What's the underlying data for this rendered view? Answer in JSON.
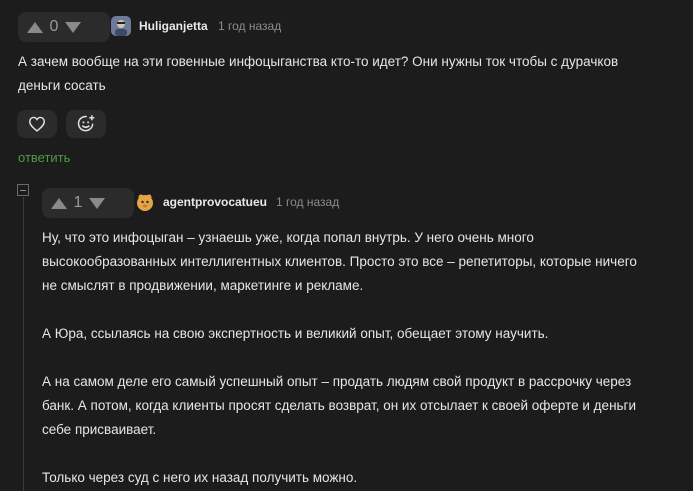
{
  "comment_main": {
    "votes": "0",
    "username": "Huliganjetta",
    "time": "1 год назад",
    "text": "А зачем вообще на эти говенные инфоцыганства кто-то идет? Они нужны ток чтобы с дурачков деньги сосать",
    "reply_label": "ответить"
  },
  "comment_reply": {
    "votes": "1",
    "username": "agentprovocatueu",
    "time": "1 год назад",
    "paragraphs": [
      "Ну, что это инфоцыган – узнаешь уже, когда попал внутрь. У него очень много высокообразованных интеллигентных клиентов. Просто это все – репетиторы, которые ничего не смыслят в продвижении, маркетинге и рекламе.",
      "А Юра, ссылаясь на свою экспертность и великий опыт, обещает этому научить.",
      "А на самом деле его самый успешный опыт – продать людям свой продукт в рассрочку через банк. А потом, когда клиенты просят сделать возврат, он их отсылает к своей оферте и деньги себе присваивает.",
      "Только через суд с него их назад получить можно."
    ]
  },
  "icons": {
    "upvote": "upvote-icon",
    "downvote": "downvote-icon",
    "like": "heart-icon",
    "reaction": "emoji-add-icon",
    "collapse": "collapse-icon"
  }
}
